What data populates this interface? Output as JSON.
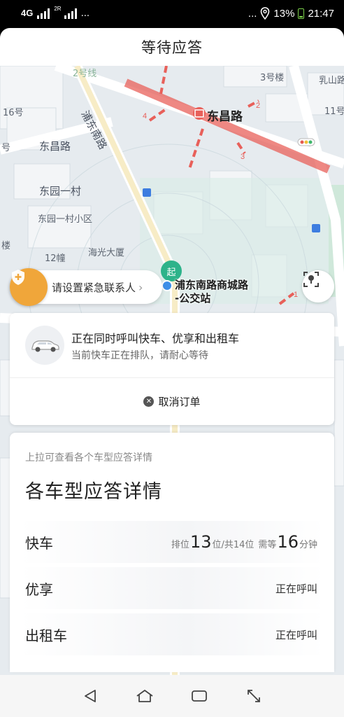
{
  "status_bar": {
    "network": "4G",
    "sim2": "2R",
    "dots_left": "...",
    "dots_right": "...",
    "battery": "13%",
    "time": "21:47"
  },
  "header": {
    "title": "等待应答"
  },
  "map": {
    "labels": {
      "l_16hao": "16号",
      "l_dongchanglu_main": "东昌路",
      "l_dongchanglu_road": "东昌路",
      "l_pudongnanlu": "浦东南路",
      "l_3haolou": "3号楼",
      "l_rushanlu": "乳山路",
      "l_11hao": "11号",
      "l_dongyuanyicun": "东园一村",
      "l_dongyuanyicun_xq": "东园一村小区",
      "l_12chuang": "12幢",
      "l_haiguangdasha": "海光大厦",
      "l_lou": "楼",
      "l_hao": "号",
      "l_2haoxian": "2号线"
    },
    "start_pin": "起",
    "stop_label_line1": "浦东南路商城路",
    "stop_label_line2": "-公交站"
  },
  "emergency": {
    "label": "请设置紧急联系人"
  },
  "call_card": {
    "line1": "正在同时呼叫快车、优享和出租车",
    "line2": "当前快车正在排队，请耐心等待",
    "cancel_label": "取消订单"
  },
  "details": {
    "hint": "上拉可查看各个车型应答详情",
    "heading": "各车型应答详情",
    "rows": [
      {
        "name": "快车",
        "queue_prefix": "排位",
        "queue_pos": "13",
        "queue_mid": "位/共14位",
        "wait_prefix": "需等",
        "wait_min": "16",
        "wait_suffix": "分钟"
      },
      {
        "name": "优享",
        "status": "正在呼叫"
      },
      {
        "name": "出租车",
        "status": "正在呼叫"
      }
    ]
  },
  "colors": {
    "accent_green": "#2db38a",
    "emergency_orange": "#f0a63a",
    "metro_red": "#e8605a",
    "map_bg": "#e6ebef"
  }
}
